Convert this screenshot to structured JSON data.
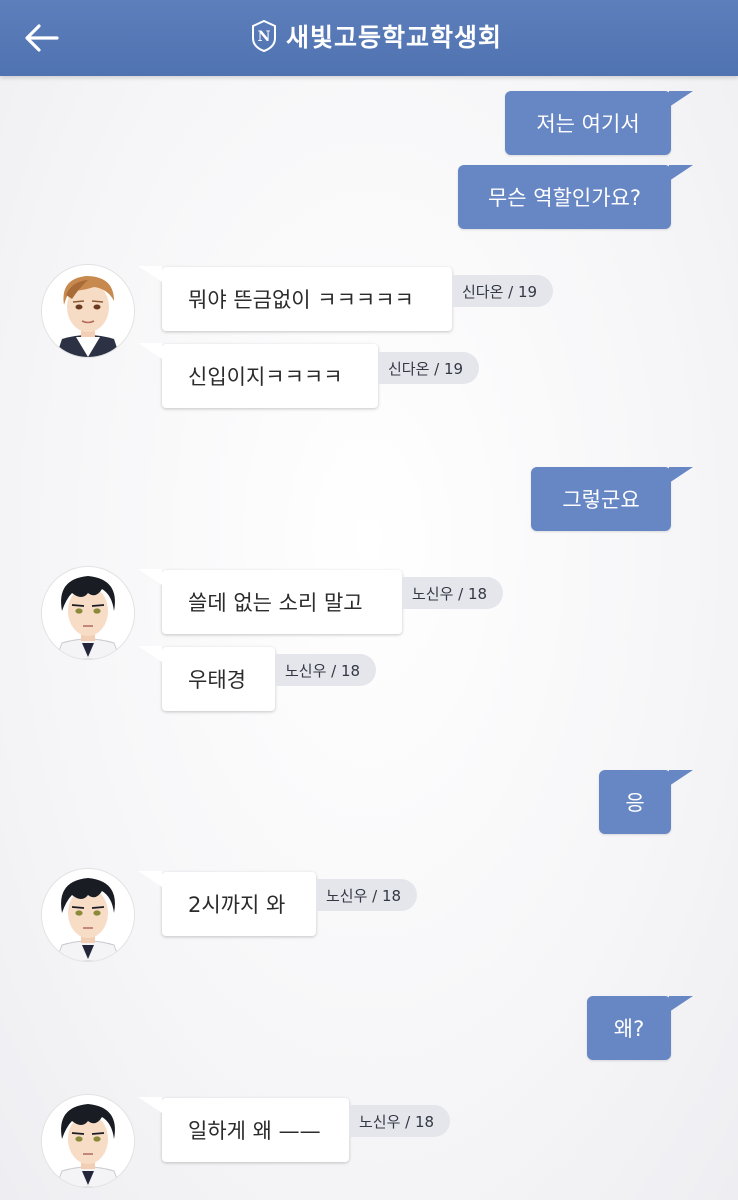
{
  "header": {
    "title": "새빛고등학교학생회",
    "logo_letter": "N",
    "back_icon": "arrow-left-icon",
    "color": "#5677b5"
  },
  "colors": {
    "outgoing_bubble": "#6786c4",
    "incoming_bubble": "#ffffff",
    "name_tag": "#e4e6ec"
  },
  "messages": [
    {
      "dir": "out",
      "text": "저는 여기서"
    },
    {
      "dir": "out",
      "text": "무슨 역할인가요?"
    },
    {
      "dir": "in",
      "text": "뭐야 뜬금없이 ㅋㅋㅋㅋㅋ",
      "sender": "신다온 / 19"
    },
    {
      "dir": "in",
      "text": "신입이지ㅋㅋㅋㅋ",
      "sender": "신다온 / 19"
    },
    {
      "dir": "out",
      "text": "그렇군요"
    },
    {
      "dir": "in",
      "text": "쓸데 없는 소리 말고",
      "sender": "노신우 / 18"
    },
    {
      "dir": "in",
      "text": "우태경",
      "sender": "노신우 / 18"
    },
    {
      "dir": "out",
      "text": "응"
    },
    {
      "dir": "in",
      "text": "2시까지 와",
      "sender": "노신우 / 18"
    },
    {
      "dir": "out",
      "text": "왜?"
    },
    {
      "dir": "in",
      "text": "일하게 왜 ——",
      "sender": "노신우 / 18"
    }
  ]
}
